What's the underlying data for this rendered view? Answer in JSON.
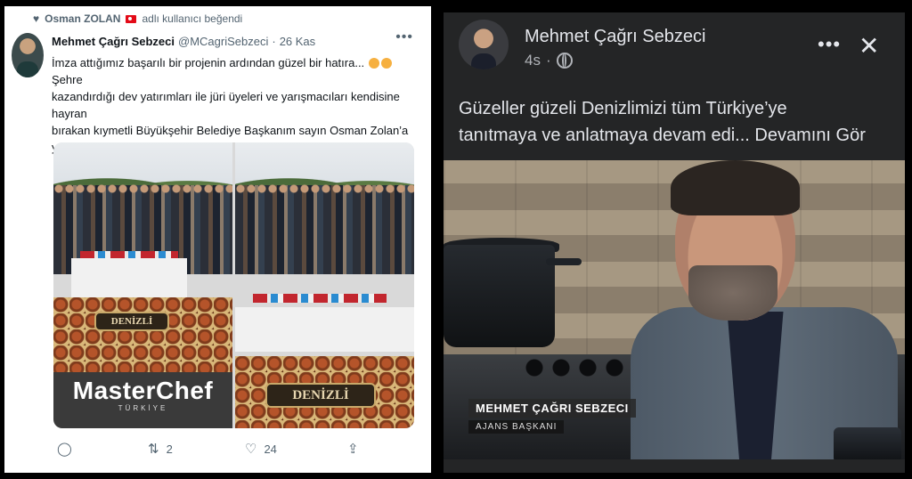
{
  "tweet": {
    "liked_by_name": "Osman ZOLAN",
    "liked_by_suffix": "adlı kullanıcı beğendi",
    "author_name": "Mehmet Çağrı Sebzeci",
    "author_handle": "@MCagriSebzeci",
    "separator": "·",
    "date": "26 Kas",
    "more_icon": "more-icon",
    "text_line1": "İmza attığımız başarılı bir projenin ardından güzel bir hatıra...",
    "text_after_emoji": "Şehre",
    "text_line2": "kazandırdığı dev yatırımları ile jüri üyeleri ve yarışmacıları kendisine hayran",
    "text_line3": "bırakan kıymetli Büyükşehir Belediye Başkanım sayın Osman Zolan’a",
    "text_line4": "yürekten teşekkürler. Bugün yine kazanan Denizlimiz oldu.",
    "photo_a_sign": "DENİZLİ",
    "photo_b_sign": "DENİZLİ",
    "masterchef_logo": "MasterChef",
    "masterchef_sub": "TÜRKİYE",
    "reply_count": "",
    "retweet_count": "2",
    "like_count": "24",
    "icons": {
      "reply": "reply-icon",
      "retweet": "retweet-icon",
      "like": "heart-icon",
      "share": "share-icon",
      "flag": "turkey-flag-icon"
    }
  },
  "facebook": {
    "author_name": "Mehmet Çağrı Sebzeci",
    "time": "4s",
    "separator": "·",
    "caption_line1": "Güzeller güzeli Denizlimizi tüm Türkiye’ye",
    "caption_line2": "tanıtmaya ve anlatmaya devam edi...",
    "see_more": "Devamını Gör",
    "lower_third_name": "MEHMET ÇAĞRI SEBZECI",
    "lower_third_title": "AJANS BAŞKANI",
    "icons": {
      "privacy": "globe-icon",
      "more": "more-icon",
      "close": "close-icon"
    }
  },
  "colors": {
    "twitter_gray": "#536471",
    "fb_bg": "#242526",
    "fb_text": "#e4e6eb"
  }
}
